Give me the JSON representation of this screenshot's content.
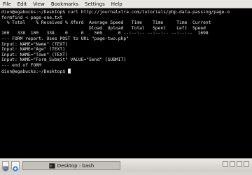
{
  "menubar": {
    "items": [
      "File",
      "Edit",
      "View",
      "Bookmarks",
      "Settings",
      "Help"
    ]
  },
  "terminal": {
    "lines": [
      "dion@egabucks:~/Desktop$ curl http://journalxtra.com/tutorials/php-data-passing/page-o",
      "formfind < page-one.txt",
      "  % Total    % Received % Xferd  Average Speed   Time    Time     Time  Current",
      "                                 Dload  Upload   Total   Spent    Left  Speed",
      "100   338  100   338    0     0    560      0 --:--:-- --:--:-- --:--:--  1698",
      "--- FORM report. Uses POST to URL \"page-two.php\"",
      "Input: NAME=\"Name\" (TEXT)",
      "Input: NAME=\"Age\" (TEXT)",
      "Input: NAME=\"Town\" (TEXT)",
      "Input: NAME=\"Form_Submit\" VALUE=\"Send\" (SUBMIT)",
      "--- end of FORM"
    ],
    "prompt": "dion@egabucks:~/Desktop$ "
  },
  "taskbar": {
    "task_label": "Desktop : bash"
  }
}
